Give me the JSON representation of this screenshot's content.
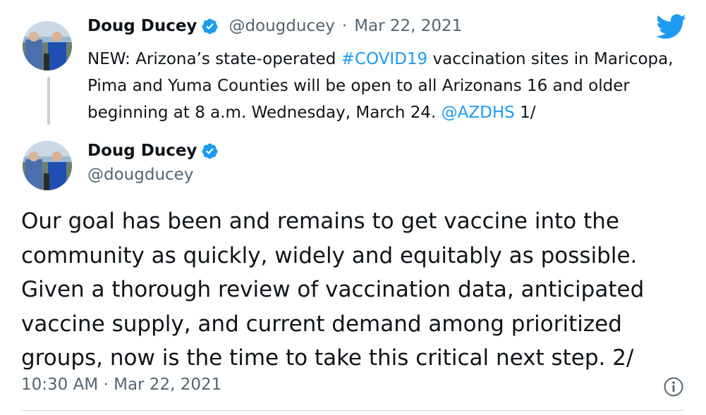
{
  "quoted_tweet": {
    "author_name": "Doug Ducey",
    "handle": "@dougducey",
    "separator": "·",
    "date": "Mar 22, 2021",
    "text_parts": [
      "NEW: Arizona’s state-operated ",
      "#COVID19",
      " vaccination sites in Maricopa, Pima and Yuma Counties will be open to all Arizonans 16 and older beginning at 8 a.m. Wednesday, March 24. ",
      "@AZDHS",
      " 1/"
    ]
  },
  "main_tweet": {
    "author_name": "Doug Ducey",
    "handle": "@dougducey",
    "text": "Our goal has been and remains to get vaccine into the community as quickly, widely and equitably as possible. Given a thorough review of vaccination data, anticipated vaccine supply, and current demand among prioritized groups, now is the time to take this critical next step. 2/",
    "timestamp": "10:30 AM · Mar 22, 2021"
  },
  "icons": {
    "verified": "verified-badge-icon",
    "brand": "twitter-bird-icon",
    "info": "info-icon"
  },
  "colors": {
    "link": "#1d9bf0",
    "verified": "#1d9bf0",
    "secondary_text": "#536471",
    "thread_line": "#c4cfd6"
  }
}
